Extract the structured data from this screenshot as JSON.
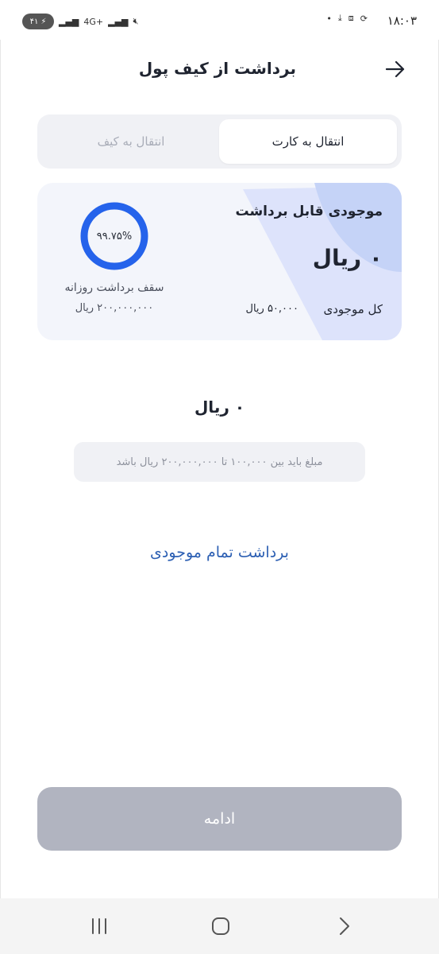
{
  "status_bar": {
    "time": "۱۸:۰۳",
    "battery": "۴۱",
    "network": "4G+"
  },
  "header": {
    "title": "برداشت از کیف پول",
    "back_icon": "arrow-right-icon"
  },
  "tabs": [
    {
      "label": "انتقال به کارت",
      "active": true
    },
    {
      "label": "انتقال به کیف",
      "active": false
    }
  ],
  "balance_card": {
    "title": "موجودی قابل برداشت",
    "amount": "۰ ریال",
    "total_label": "کل موجودی",
    "total_value": "۵۰,۰۰۰ ریال",
    "daily_cap_percent": "۹۹.۷۵%",
    "daily_cap_fraction": 0.9975,
    "daily_cap_label": "سقف برداشت روزانه",
    "daily_cap_value": "۲۰۰,۰۰۰,۰۰۰ ریال"
  },
  "amount_input": {
    "value": "۰ ریال",
    "hint": "مبلغ باید بین ۱۰۰,۰۰۰ تا ۲۰۰,۰۰۰,۰۰۰ ریال باشد"
  },
  "withdraw_all_label": "برداشت تمام موجودی",
  "continue_label": "ادامه",
  "colors": {
    "accent": "#2c5fb3",
    "ring": "#2563eb",
    "disabled_button": "#b1b4c0",
    "card_bg": "#f3f5fb"
  }
}
